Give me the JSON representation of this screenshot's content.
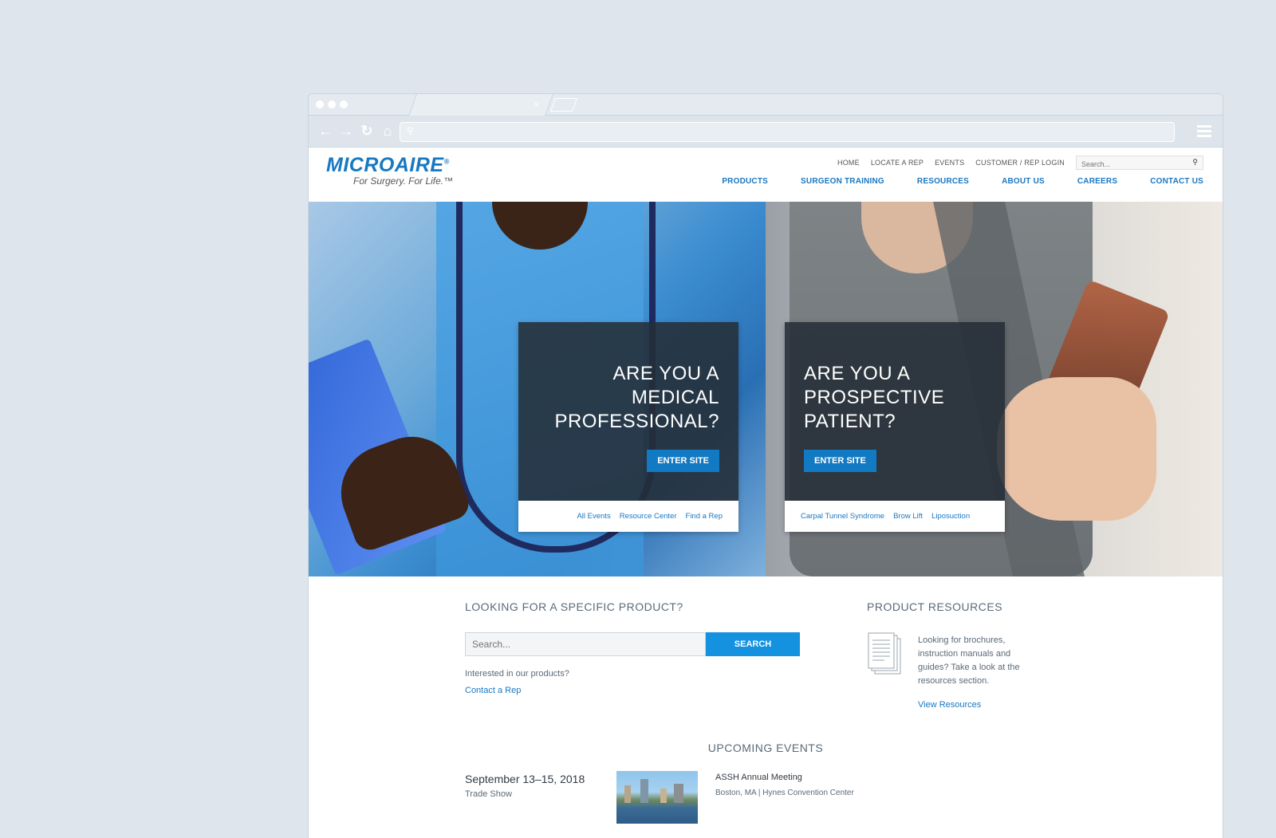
{
  "browser": {
    "tab_close": "×"
  },
  "brand": {
    "logo": "MICROAIRE",
    "registered": "®",
    "tagline": "For Surgery. For Life.™",
    "accent_color": "#1a78c1"
  },
  "topnav": {
    "items": [
      "HOME",
      "LOCATE A REP",
      "EVENTS",
      "CUSTOMER / REP LOGIN"
    ],
    "search_placeholder": "Search..."
  },
  "mainnav": {
    "items": [
      "PRODUCTS",
      "SURGEON TRAINING",
      "RESOURCES",
      "ABOUT US",
      "CAREERS",
      "CONTACT US"
    ]
  },
  "hero": {
    "left": {
      "title": "ARE YOU A MEDICAL PROFESSIONAL?",
      "button": "ENTER SITE",
      "links": [
        "All Events",
        "Resource Center",
        "Find a Rep"
      ]
    },
    "right": {
      "title": "ARE YOU A PROSPECTIVE PATIENT?",
      "button": "ENTER SITE",
      "links": [
        "Carpal Tunnel Syndrome",
        "Brow Lift",
        "Liposuction"
      ]
    }
  },
  "product_search": {
    "heading": "LOOKING FOR A SPECIFIC PRODUCT?",
    "placeholder": "Search...",
    "button": "SEARCH",
    "interest_text": "Interested in our products?",
    "contact_link": "Contact a Rep"
  },
  "product_resources": {
    "heading": "PRODUCT RESOURCES",
    "text": "Looking for brochures, instruction manuals and guides? Take a look at the resources section.",
    "link": "View Resources"
  },
  "events": {
    "heading": "UPCOMING EVENTS",
    "items": [
      {
        "date": "September 13–15, 2018",
        "type": "Trade Show",
        "name": "ASSH Annual Meeting",
        "location": "Boston, MA | Hynes Convention Center"
      }
    ]
  }
}
